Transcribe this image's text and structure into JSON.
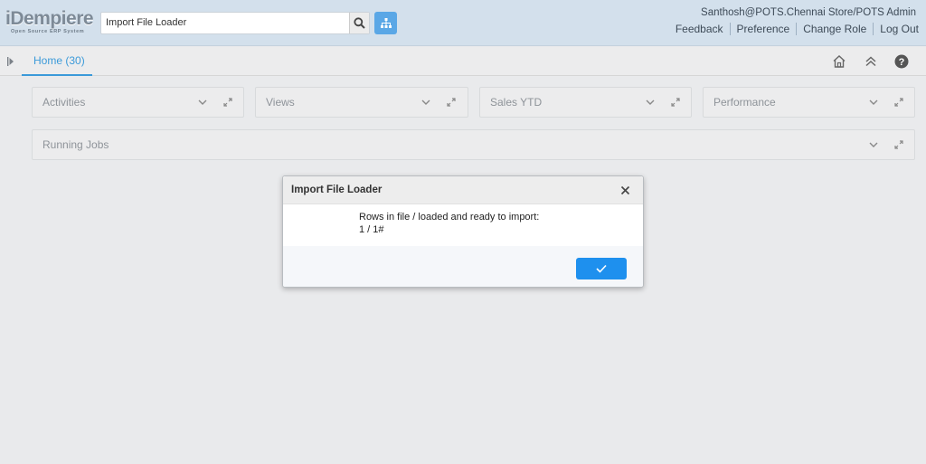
{
  "header": {
    "logo": "iDempiere",
    "logo_subtitle": "Open Source ERP System",
    "search_value": "Import File Loader",
    "user": "Santhosh@POTS.Chennai Store/POTS Admin",
    "links": [
      "Feedback",
      "Preference",
      "Change Role",
      "Log Out"
    ]
  },
  "tabs": {
    "home": "Home (30)"
  },
  "dashboard": {
    "panels": [
      "Activities",
      "Views",
      "Sales YTD",
      "Performance"
    ],
    "running_jobs": "Running Jobs"
  },
  "dialog": {
    "title": "Import File Loader",
    "line1": "Rows in file / loaded and ready to import:",
    "line2": "1 / 1#"
  },
  "colors": {
    "accent": "#3b9ad9",
    "ok_button": "#1e90ee",
    "header_bg": "#d3e0ec"
  }
}
